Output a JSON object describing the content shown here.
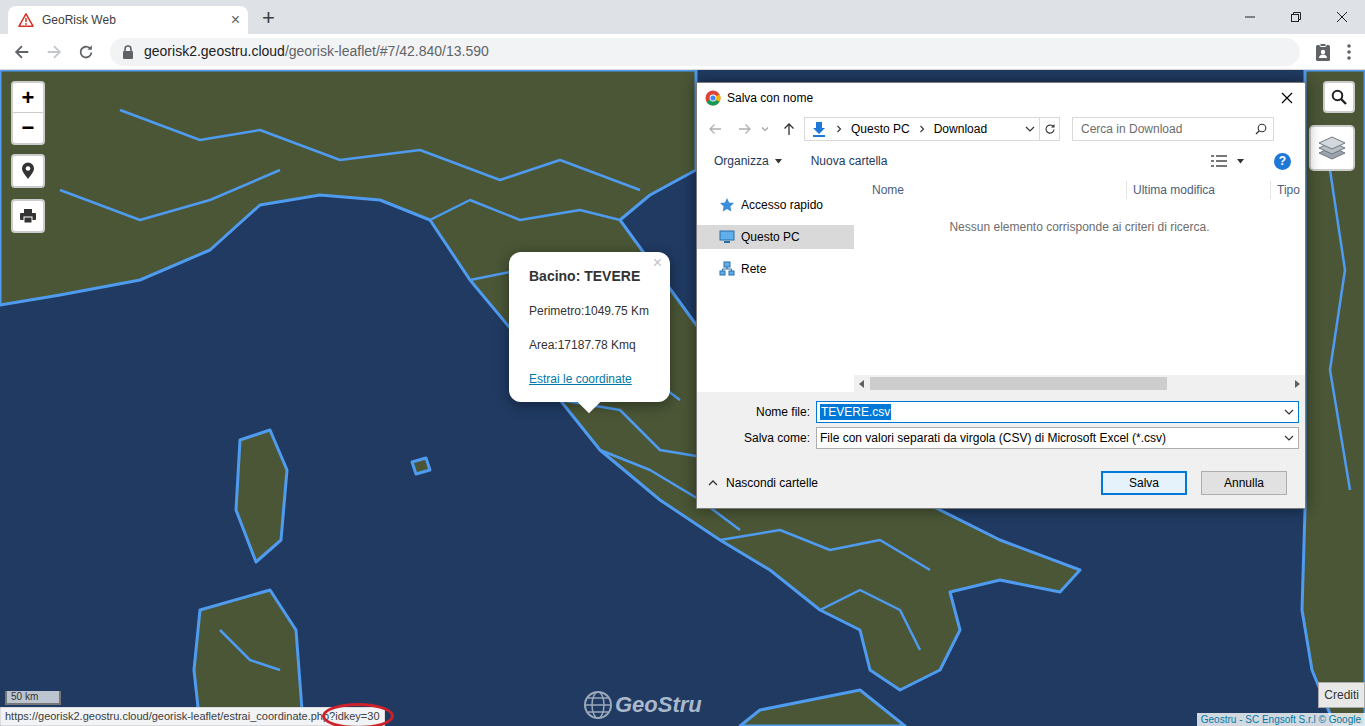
{
  "browser": {
    "tab": {
      "title": "GeoRisk Web",
      "close": "×"
    },
    "new_tab": "+",
    "nav": {
      "back_disabled": false,
      "forward_disabled": true
    },
    "address": {
      "host": "georisk2.geostru.cloud",
      "path": "/georisk-leaflet/#7/42.840/13.590"
    }
  },
  "map": {
    "zoom_in": "+",
    "zoom_out": "−",
    "scale": "50 km",
    "logo": "GeoStru",
    "attribution": "Geostru - SC Engsoft S.r.l © Google",
    "credits": "Crediti",
    "popup": {
      "title": "Bacino: TEVERE",
      "close": "×",
      "perimeter": "Perimetro:1049.75 Km",
      "area": "Area:17187.78 Kmq",
      "link": "Estrai le coordinate"
    }
  },
  "status_bar": {
    "url": "https://georisk2.geostru.cloud/georisk-leaflet/estrai_coordinate.php?idkey=30"
  },
  "dialog": {
    "title": "Salva con nome",
    "nav": {
      "back_disabled": true,
      "forward_disabled": true
    },
    "breadcrumb": [
      "Questo PC",
      "Download"
    ],
    "search": {
      "placeholder": "Cerca in Download"
    },
    "toolbar": [
      "Organizza",
      "Nuova cartella"
    ],
    "help": "?",
    "sidebar": [
      {
        "label": "Accesso rapido",
        "selected": false
      },
      {
        "label": "Questo PC",
        "selected": true
      },
      {
        "label": "Rete",
        "selected": false
      }
    ],
    "columns": [
      "Nome",
      "Ultima modifica",
      "Tipo"
    ],
    "empty": "Nessun elemento corrisponde ai criteri di ricerca.",
    "scrollbar": {
      "level": 0.71
    },
    "file_name": {
      "label": "Nome file:",
      "value": "TEVERE.csv",
      "selected": true
    },
    "save_as": {
      "label": "Salva come:",
      "value": "File con valori separati da virgola (CSV) di Microsoft Excel (*.csv)"
    },
    "hide_folders": "Nascondi cartelle",
    "buttons": [
      {
        "label": "Salva",
        "default": true
      },
      {
        "label": "Annulla",
        "default": false
      }
    ]
  }
}
